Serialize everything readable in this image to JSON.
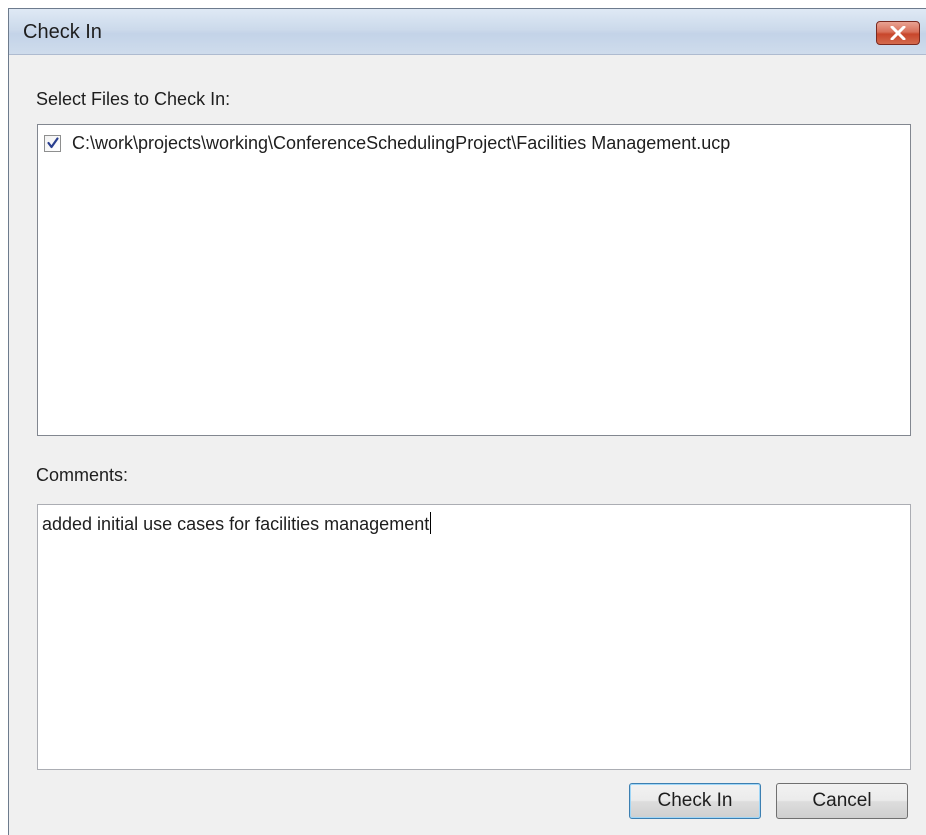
{
  "window": {
    "title": "Check In"
  },
  "files_section": {
    "label": "Select Files to Check In:",
    "files": [
      {
        "checked": true,
        "path": "C:\\work\\projects\\working\\ConferenceSchedulingProject\\Facilities Management.ucp"
      }
    ]
  },
  "comments_section": {
    "label": "Comments:",
    "value": "added initial use cases for facilities management"
  },
  "buttons": {
    "check_in_label": "Check In",
    "cancel_label": "Cancel"
  },
  "icons": {
    "close": "close-icon",
    "check": "checkmark-icon"
  },
  "colors": {
    "close_button": "#c8462c",
    "title_bar": "#ccdaeb",
    "default_button_border": "#3c7fb1"
  }
}
